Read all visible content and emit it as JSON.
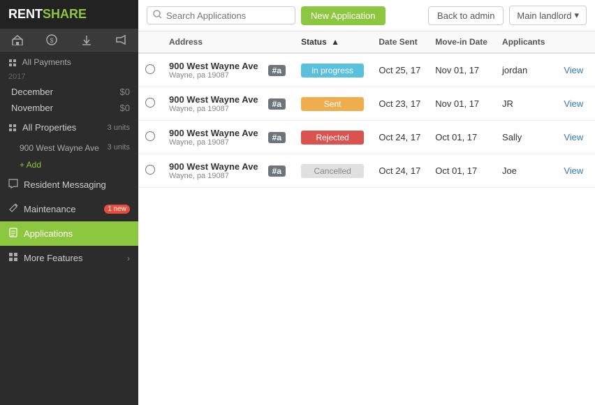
{
  "logo": {
    "rent": "RENT",
    "share": "SHARE"
  },
  "sidebar": {
    "toolbar": [
      {
        "icon": "⊞",
        "name": "add-property-icon"
      },
      {
        "icon": "💵",
        "name": "payment-icon"
      },
      {
        "icon": "⬇",
        "name": "download-icon"
      },
      {
        "icon": "📢",
        "name": "announce-icon"
      }
    ],
    "all_payments_label": "All Payments",
    "year_2017": "2017",
    "payment_months": [
      {
        "month": "December",
        "amount": "$0"
      },
      {
        "month": "November",
        "amount": "$0"
      }
    ],
    "all_properties_label": "All Properties",
    "all_properties_count": "3 units",
    "properties": [
      {
        "name": "900 West Wayne Ave",
        "units": "3 units"
      }
    ],
    "add_property_label": "+ Add",
    "nav_items": [
      {
        "id": "resident-messaging",
        "icon": "✈",
        "label": "Resident Messaging",
        "badge": null
      },
      {
        "id": "maintenance",
        "icon": "🔧",
        "label": "Maintenance",
        "badge": "1 new"
      },
      {
        "id": "applications",
        "icon": "📄",
        "label": "Applications",
        "badge": null,
        "active": true
      },
      {
        "id": "more-features",
        "icon": "⊞",
        "label": "More Features",
        "badge": null,
        "chevron": "›"
      }
    ]
  },
  "topbar": {
    "search_placeholder": "Search Applications",
    "new_app_label": "New Application",
    "back_admin_label": "Back to admin",
    "landlord_label": "Main landlord",
    "landlord_chevron": "▾"
  },
  "table": {
    "columns": [
      {
        "id": "address",
        "label": "Address"
      },
      {
        "id": "status",
        "label": "Status",
        "sort": "▲"
      },
      {
        "id": "date_sent",
        "label": "Date Sent"
      },
      {
        "id": "movein_date",
        "label": "Move-in Date"
      },
      {
        "id": "applicants",
        "label": "Applicants"
      }
    ],
    "rows": [
      {
        "address": "900 West Wayne Ave",
        "address_sub": "Wayne, pa 19087",
        "unit": "#a",
        "status": "in progress",
        "status_class": "status-inprogress",
        "date_sent": "Oct 25, 17",
        "movein_date": "Nov 01, 17",
        "applicants": "jordan",
        "view_label": "View"
      },
      {
        "address": "900 West Wayne Ave",
        "address_sub": "Wayne, pa 19087",
        "unit": "#a",
        "status": "Sent",
        "status_class": "status-sent",
        "date_sent": "Oct 23, 17",
        "movein_date": "Nov 01, 17",
        "applicants": "JR",
        "view_label": "View"
      },
      {
        "address": "900 West Wayne Ave",
        "address_sub": "Wayne, pa 19087",
        "unit": "#a",
        "status": "Rejected",
        "status_class": "status-rejected",
        "date_sent": "Oct 24, 17",
        "movein_date": "Oct 01, 17",
        "applicants": "Sally",
        "view_label": "View"
      },
      {
        "address": "900 West Wayne Ave",
        "address_sub": "Wayne, pa 19087",
        "unit": "#a",
        "status": "Cancelled",
        "status_class": "status-cancelled",
        "date_sent": "Oct 24, 17",
        "movein_date": "Oct 01, 17",
        "applicants": "Joe",
        "view_label": "View"
      }
    ]
  }
}
